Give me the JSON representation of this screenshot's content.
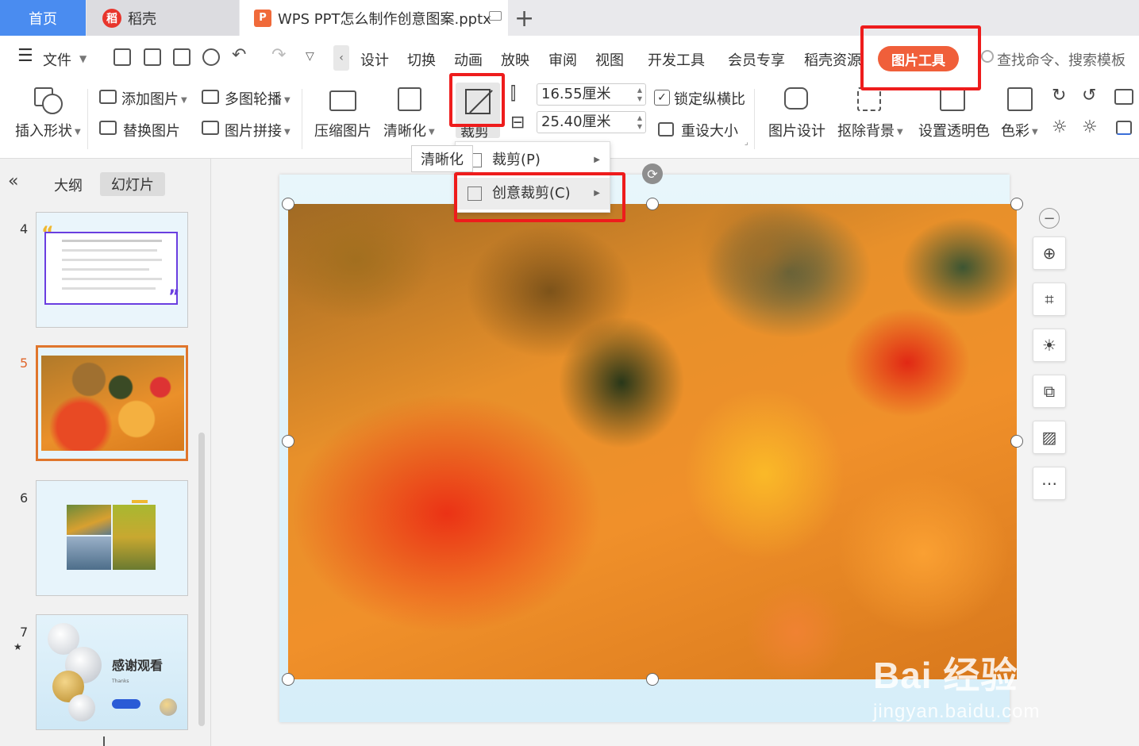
{
  "tabs": {
    "home": "首页",
    "daoke": "稻壳",
    "daoke_logo": "稻",
    "document": "WPS PPT怎么制作创意图案.pptx",
    "doc_logo": "P",
    "plus": "+"
  },
  "menu": {
    "file": "文件",
    "items": [
      "设计",
      "切换",
      "动画",
      "放映",
      "审阅",
      "视图",
      "开发工具",
      "会员专享",
      "稻壳资源"
    ],
    "active_tool": "图片工具",
    "search_placeholder": "查找命令、搜索模板",
    "back_glyph": "‹"
  },
  "ribbon": {
    "insert_shape": "插入形状",
    "add_picture": "添加图片",
    "replace_picture": "替换图片",
    "multi_carousel": "多图轮播",
    "picture_collage": "图片拼接",
    "compress_picture": "压缩图片",
    "sharpen": "清晰化",
    "crop": "裁剪",
    "height_value": "16.55厘米",
    "width_value": "25.40厘米",
    "lock_ratio": "锁定纵横比",
    "reset_size": "重设大小",
    "picture_design": "图片设计",
    "remove_background": "抠除背景",
    "set_transparent": "设置透明色",
    "color": "色彩"
  },
  "dropdown": {
    "tooltip": "清晰化",
    "items": [
      {
        "label": "裁剪(P)"
      },
      {
        "label": "创意裁剪(C)"
      }
    ]
  },
  "panel": {
    "collapse_glyph": "«",
    "outline_tab": "大纲",
    "slides_tab": "幻灯片",
    "slides": [
      {
        "num": "4"
      },
      {
        "num": "5"
      },
      {
        "num": "6"
      },
      {
        "num": "7",
        "title": "感谢观看",
        "subtitle": "Thanks"
      }
    ],
    "star": "★"
  },
  "watermark": {
    "main": "Bai 经验",
    "sub": "jingyan.baidu.com"
  },
  "colors": {
    "accent_blue": "#4a8cf0",
    "tool_orange": "#f05f3a",
    "highlight_red": "#ee1c1c",
    "active_slide": "#e0762c"
  }
}
